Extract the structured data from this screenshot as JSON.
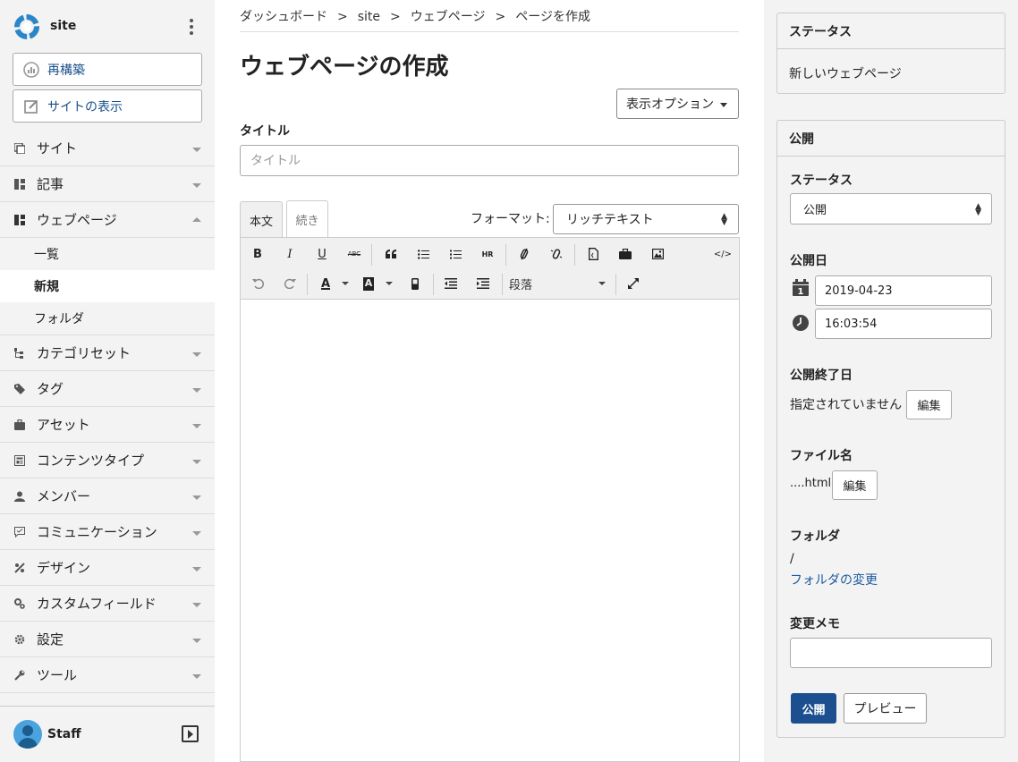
{
  "sidebar": {
    "site_name": "site",
    "rebuild_label": "再構築",
    "view_site_label": "サイトの表示",
    "nav": [
      {
        "label": "サイト"
      },
      {
        "label": "記事"
      },
      {
        "label": "ウェブページ"
      },
      {
        "label": "カテゴリセット"
      },
      {
        "label": "タグ"
      },
      {
        "label": "アセット"
      },
      {
        "label": "コンテンツタイプ"
      },
      {
        "label": "メンバー"
      },
      {
        "label": "コミュニケーション"
      },
      {
        "label": "デザイン"
      },
      {
        "label": "カスタムフィールド"
      },
      {
        "label": "設定"
      },
      {
        "label": "ツール"
      }
    ],
    "webpage_sub": [
      {
        "label": "一覧"
      },
      {
        "label": "新規"
      },
      {
        "label": "フォルダ"
      }
    ],
    "user_name": "Staff"
  },
  "main": {
    "breadcrumb": [
      "ダッシュボード",
      "site",
      "ウェブページ",
      "ページを作成"
    ],
    "breadcrumb_sep": ">",
    "page_title": "ウェブページの作成",
    "display_options_label": "表示オプション",
    "title_label": "タイトル",
    "title_placeholder": "タイトル",
    "tab_body": "本文",
    "tab_more": "続き",
    "format_label": "フォーマット:",
    "format_value": "リッチテキスト",
    "toolbar": {
      "bold": "B",
      "italic": "I",
      "underline": "U",
      "strike": "ABC",
      "hr": "HR",
      "paragraph": "段落",
      "text_color": "A",
      "bg_color": "A",
      "code": "</>"
    }
  },
  "right": {
    "status_card": {
      "title": "ステータス",
      "value": "新しいウェブページ"
    },
    "publish_card": {
      "title": "公開",
      "status_label": "ステータス",
      "status_value": "公開",
      "pub_date_label": "公開日",
      "date_value": "2019-04-23",
      "time_value": "16:03:54",
      "calendar_day": "1",
      "unpub_label": "公開終了日",
      "unpub_value": "指定されていません",
      "edit_label": "編集",
      "filename_label": "ファイル名",
      "filename_value": "....html",
      "folder_label": "フォルダ",
      "folder_value": "/",
      "change_folder_link": "フォルダの変更",
      "memo_label": "変更メモ",
      "publish_button": "公開",
      "preview_button": "プレビュー"
    }
  },
  "colors": {
    "accent": "#1b4f8f",
    "link": "#1a5a9e",
    "sidebar_bg": "#f3f3f3",
    "logo_blue": "#2a86c9"
  }
}
